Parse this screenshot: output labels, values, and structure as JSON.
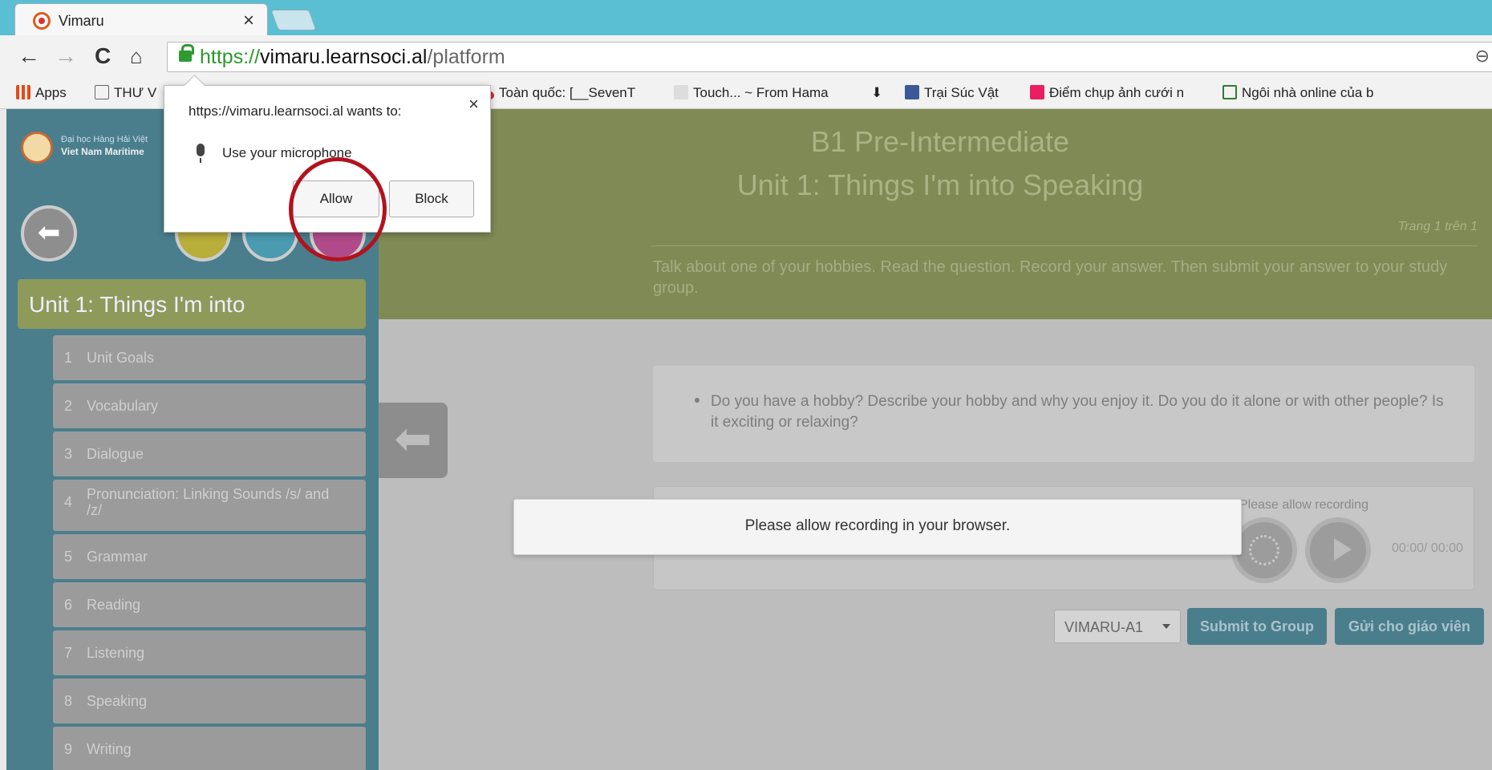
{
  "browser": {
    "tab_title": "Vimaru",
    "url": {
      "protocol": "https://",
      "host": "vimaru.learnsoci.al",
      "path": "/platform"
    },
    "bookmarks": [
      {
        "label": "Apps",
        "icon": "apps-grid-icon",
        "color": "#e64a19"
      },
      {
        "label": "THƯ V",
        "icon": "page-icon",
        "color": "#666666"
      },
      {
        "label": "Toàn quốc: [__SevenT",
        "icon": "flower-icon",
        "color": "#d32f2f"
      },
      {
        "label": "Touch... ~ From Hama",
        "icon": "image-icon",
        "color": "#9e9e9e"
      },
      {
        "label": "",
        "icon": "download-icon",
        "color": "#333333"
      },
      {
        "label": "Trại Súc Vật",
        "icon": "facebook-icon",
        "color": "#3b5998"
      },
      {
        "label": "Điểm chụp ảnh cưới n",
        "icon": "heart-icon",
        "color": "#e91e63"
      },
      {
        "label": "Ngôi nhà online của b",
        "icon": "house-icon",
        "color": "#2e7d32"
      }
    ]
  },
  "permission_popup": {
    "title": "https://vimaru.learnsoci.al wants to:",
    "request": "Use your microphone",
    "allow_label": "Allow",
    "block_label": "Block",
    "close_label": "×"
  },
  "sidebar": {
    "logo_line1": "Đại học Hàng Hải Việt",
    "logo_line2": "Viet Nam Maritime",
    "unit_title": "Unit 1: Things I'm into",
    "lessons": [
      {
        "num": "1",
        "label": "Unit Goals"
      },
      {
        "num": "2",
        "label": "Vocabulary"
      },
      {
        "num": "3",
        "label": "Dialogue"
      },
      {
        "num": "4",
        "label": "Pronunciation: Linking Sounds /s/ and /z/"
      },
      {
        "num": "5",
        "label": "Grammar"
      },
      {
        "num": "6",
        "label": "Reading"
      },
      {
        "num": "7",
        "label": "Listening"
      },
      {
        "num": "8",
        "label": "Speaking"
      },
      {
        "num": "9",
        "label": "Writing"
      }
    ]
  },
  "main": {
    "course_title": "B1 Pre-Intermediate",
    "unit_title": "Unit 1: Things I'm into Speaking",
    "page_indicator": "Trang 1 trên 1",
    "instructions": "Talk about one of your hobbies. Read the question. Record your answer. Then submit your answer to your study group.",
    "question": "Do you have a hobby? Describe your hobby and why you enjoy it. Do you do it alone or with other people? Is it exciting or relaxing?",
    "recorder_status": "Please allow recording",
    "timer": "00:00/ 00:00",
    "group_select_value": "VIMARU-A1",
    "submit_group_label": "Submit to Group",
    "send_teacher_label": "Gửi cho giáo viên",
    "toast": "Please allow recording in your browser."
  }
}
